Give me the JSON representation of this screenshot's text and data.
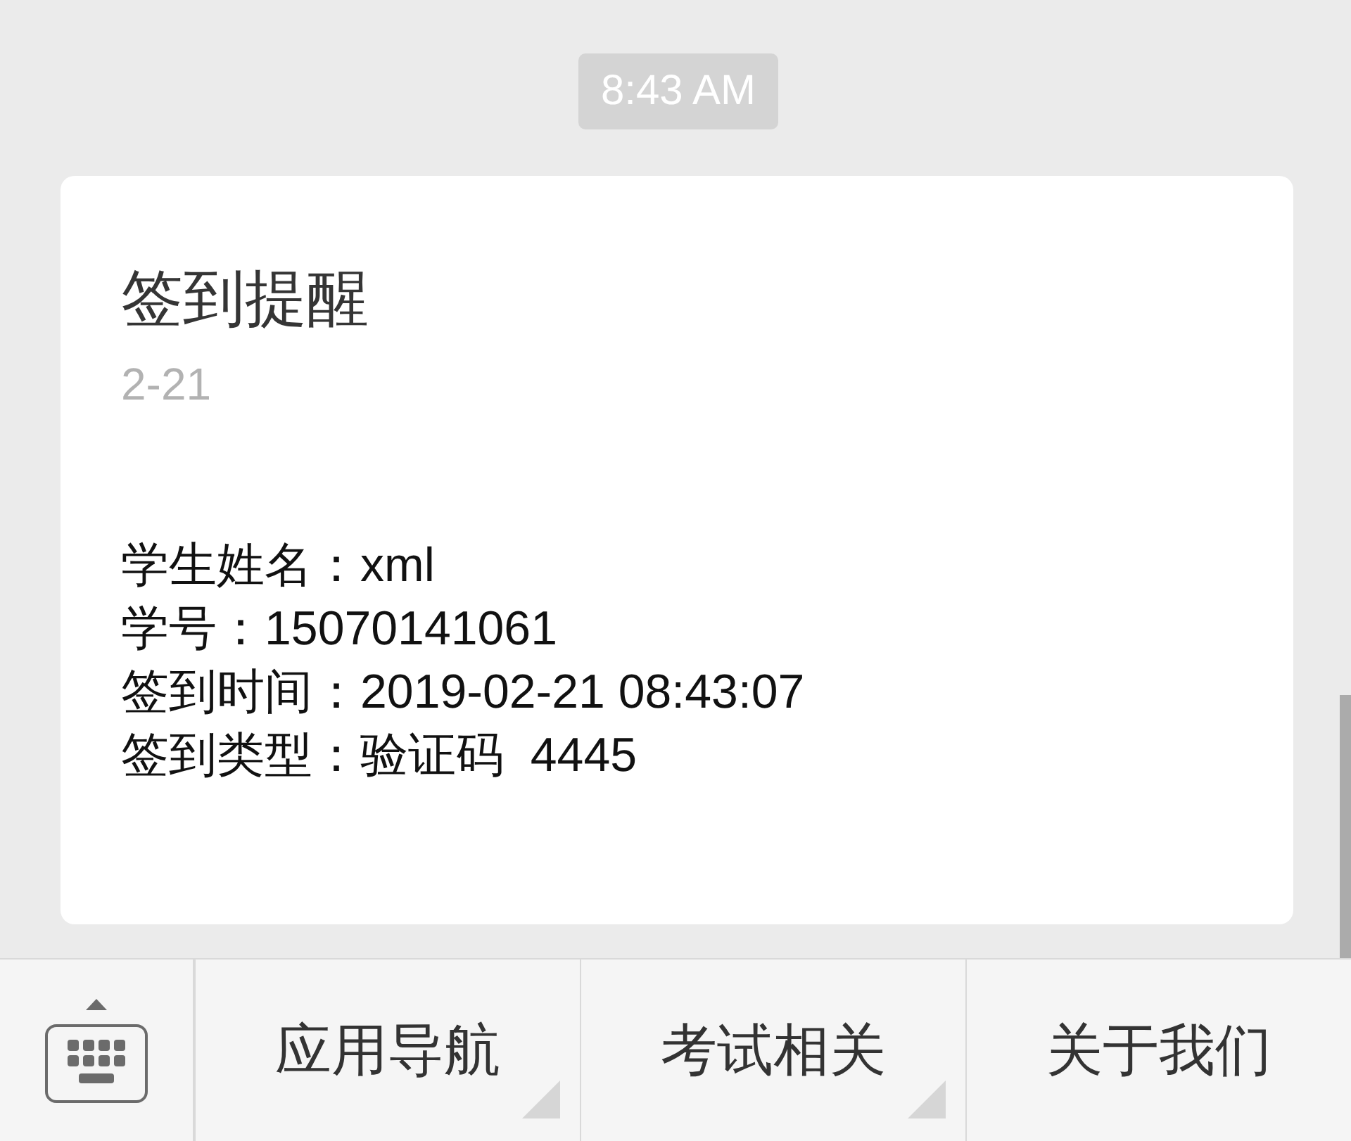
{
  "timestamp": "8:43 AM",
  "message": {
    "title": "签到提醒",
    "date": "2-21",
    "lines": [
      "学生姓名：xml",
      "学号：15070141061",
      "签到时间：2019-02-21 08:43:07",
      "签到类型：验证码  4445"
    ]
  },
  "menu_bar": {
    "items": [
      {
        "label": "应用导航",
        "submenu": true
      },
      {
        "label": "考试相关",
        "submenu": true
      },
      {
        "label": "关于我们",
        "submenu": false
      }
    ]
  }
}
